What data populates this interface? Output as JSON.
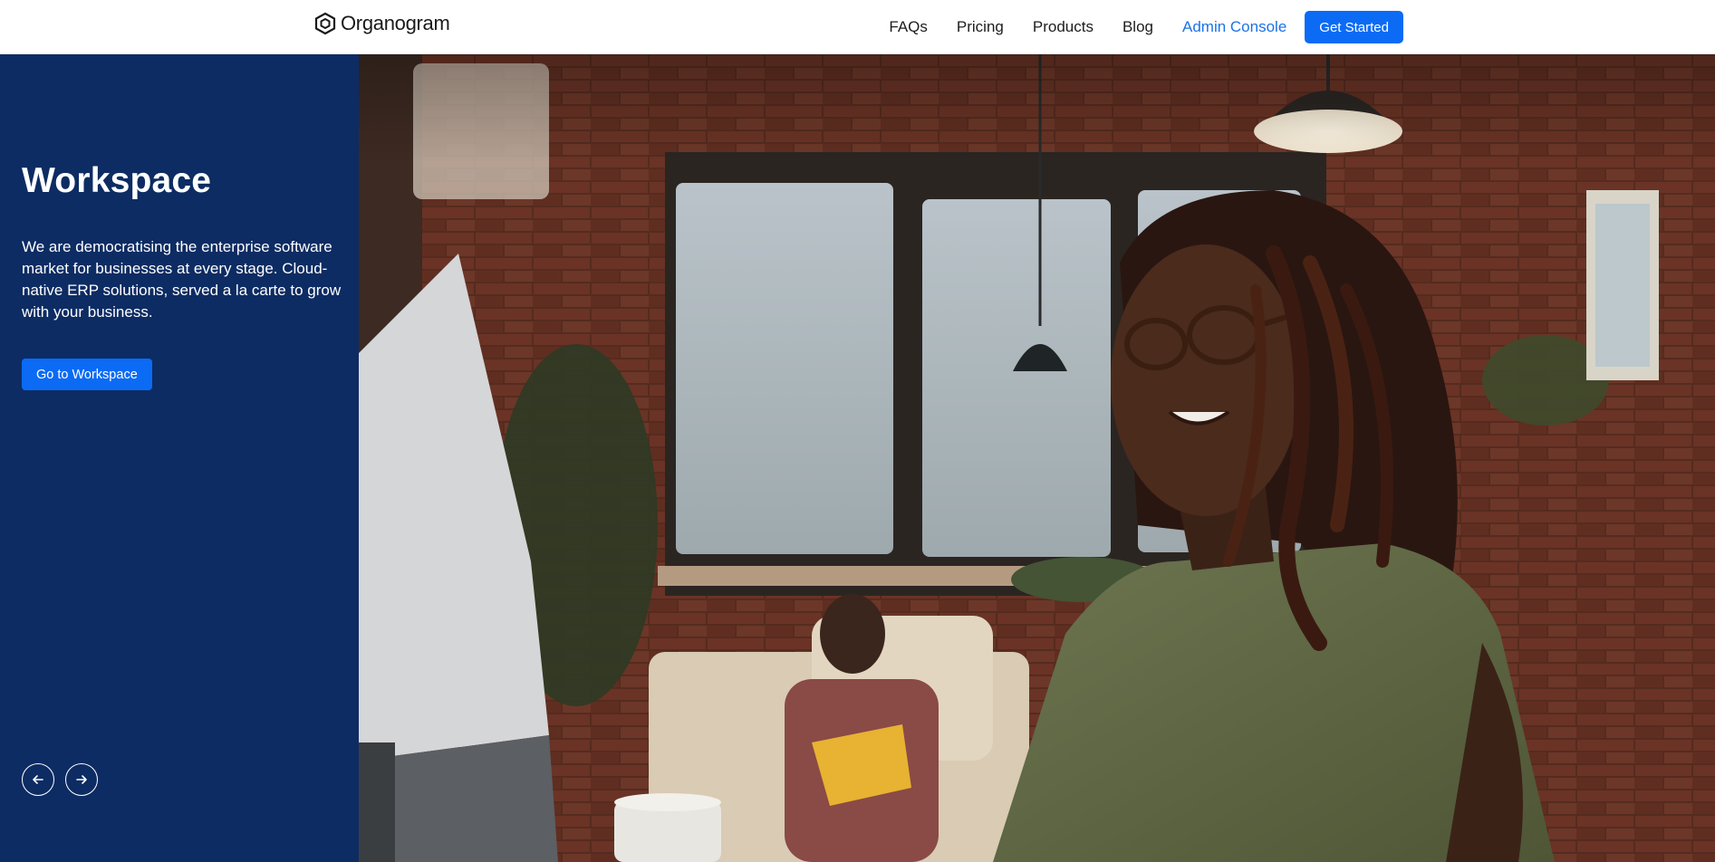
{
  "header": {
    "brand": "Organogram",
    "nav": [
      "FAQs",
      "Pricing",
      "Products",
      "Blog"
    ],
    "admin_link": "Admin Console",
    "cta": "Get Started"
  },
  "hero": {
    "title": "Workspace",
    "description": "We are democratising the enterprise software market for businesses at every stage. Cloud-native ERP solutions, served a la carte to grow with your business.",
    "button": "Go to Workspace",
    "image_alt": "Woman with glasses smiling at a computer monitor in a brick-walled office"
  },
  "carousel": {
    "prev_icon": "arrow-left-icon",
    "next_icon": "arrow-right-icon"
  },
  "colors": {
    "panel": "#0d2c63",
    "primary": "#0b6bf5",
    "admin_link": "#1a73e8"
  }
}
